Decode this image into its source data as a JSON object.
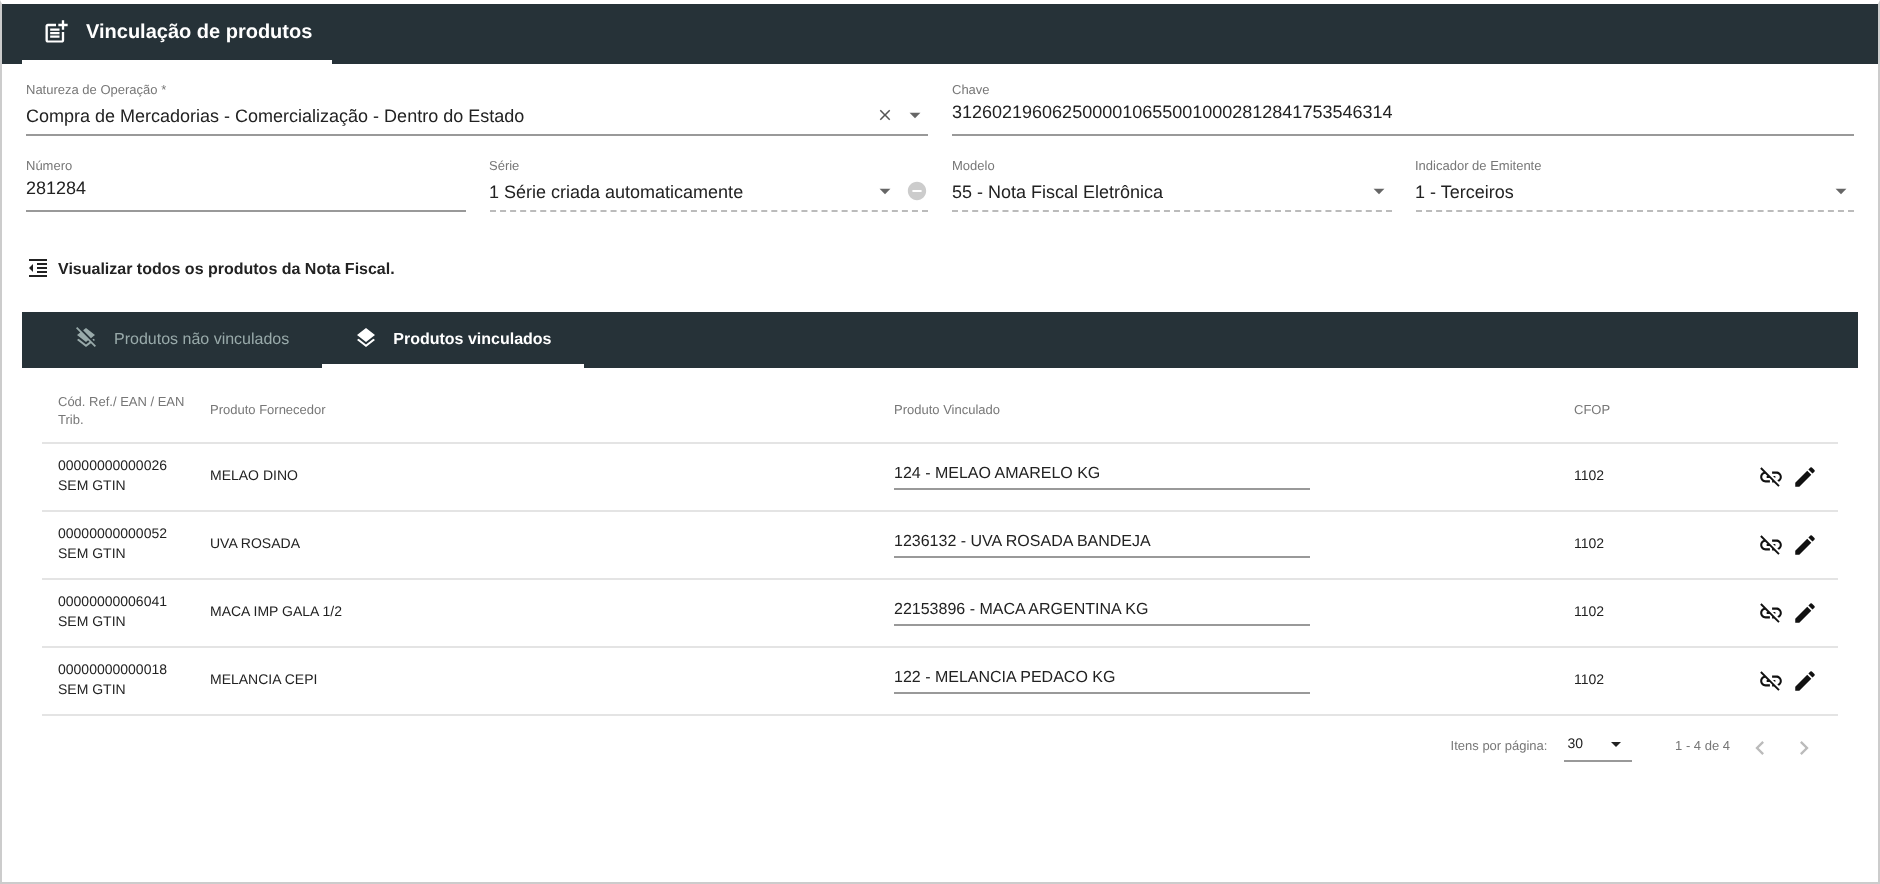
{
  "header": {
    "tabs": [
      {
        "label": "Vinculação de produtos",
        "selected": true
      }
    ]
  },
  "form": {
    "upper_fields": [
      {
        "label": "Natureza de Operação *",
        "value": "Compra de Mercadorias - Comercialização - Dentro do Estado",
        "kind": "select",
        "clearable": true,
        "disabled": false
      },
      {
        "label": "Chave",
        "value": "31260219606250000106550010002812841753546314",
        "kind": "text",
        "disabled": false
      }
    ],
    "lower_fields": [
      {
        "label": "Número",
        "value": "281284",
        "kind": "text",
        "disabled": false
      },
      {
        "label": "Série",
        "value": "1 Série criada automaticamente",
        "kind": "select",
        "disabled": true,
        "extra": true
      },
      {
        "label": "Modelo",
        "value": "55 - Nota Fiscal Eletrônica",
        "kind": "select",
        "disabled": true
      },
      {
        "label": "Indicador de Emitente",
        "value": "1 - Terceiros",
        "kind": "select",
        "disabled": true
      }
    ]
  },
  "view_all_link": "Visualizar todos os produtos da Nota Fiscal.",
  "product_tabs": [
    {
      "label": "Produtos não vinculados",
      "selected": false,
      "kind": "unlinked"
    },
    {
      "label": "Produtos vinculados",
      "selected": true,
      "kind": "linked"
    }
  ],
  "table": {
    "columns": [
      "Cód. Ref./ EAN / EAN Trib.",
      "Produto Fornecedor",
      "Produto Vinculado",
      "CFOP"
    ],
    "rows": [
      {
        "code": "00000000000026",
        "gtin": "SEM GTIN",
        "supplier_product": "MELAO DINO",
        "linked_product": "124 - MELAO AMARELO KG",
        "cfop": "1102"
      },
      {
        "code": "00000000000052",
        "gtin": "SEM GTIN",
        "supplier_product": "UVA ROSADA",
        "linked_product": "1236132 - UVA ROSADA BANDEJA",
        "cfop": "1102"
      },
      {
        "code": "00000000006041",
        "gtin": "SEM GTIN",
        "supplier_product": "MACA IMP GALA 1/2",
        "linked_product": "22153896 - MACA ARGENTINA KG",
        "cfop": "1102"
      },
      {
        "code": "00000000000018",
        "gtin": "SEM GTIN",
        "supplier_product": "MELANCIA CEPI",
        "linked_product": "122 - MELANCIA PEDACO KG",
        "cfop": "1102"
      }
    ]
  },
  "paginator": {
    "label": "Itens por página:",
    "page_size": "30",
    "range": "1 - 4 de 4",
    "prev_disabled": true,
    "next_disabled": true
  }
}
